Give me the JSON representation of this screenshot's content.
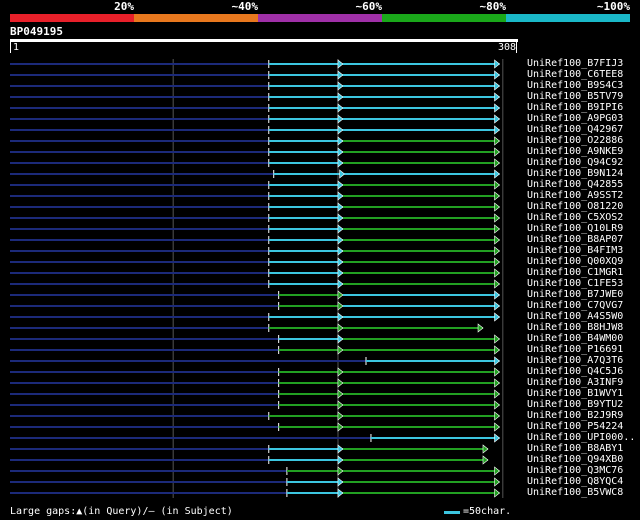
{
  "legend": {
    "labels": [
      "20%",
      "~40%",
      "~60%",
      "~80%",
      "~100%"
    ],
    "colors": [
      "#e8202a",
      "#e8781e",
      "#a030a8",
      "#1aa81a",
      "#1ab8c8"
    ]
  },
  "query": {
    "name": "BP049195",
    "start": "1",
    "end": "308"
  },
  "colors": {
    "cyan": "#3cc6e0",
    "green": "#22a022",
    "navy": "#1c2a7a",
    "grid": "#555555"
  },
  "hits": [
    {
      "label": "UniRef100_B7FIJ3",
      "segments": [
        {
          "start": 158,
          "end": 203,
          "color": "cyan"
        },
        {
          "start": 203,
          "end": 298,
          "color": "cyan"
        }
      ]
    },
    {
      "label": "UniRef100_C6TEE8",
      "segments": [
        {
          "start": 158,
          "end": 203,
          "color": "cyan"
        },
        {
          "start": 203,
          "end": 298,
          "color": "cyan"
        }
      ]
    },
    {
      "label": "UniRef100_B9S4C3",
      "segments": [
        {
          "start": 158,
          "end": 203,
          "color": "cyan"
        },
        {
          "start": 203,
          "end": 298,
          "color": "cyan"
        }
      ]
    },
    {
      "label": "UniRef100_B5TV79",
      "segments": [
        {
          "start": 158,
          "end": 203,
          "color": "cyan"
        },
        {
          "start": 203,
          "end": 298,
          "color": "cyan"
        }
      ]
    },
    {
      "label": "UniRef100_B9IPI6",
      "segments": [
        {
          "start": 158,
          "end": 203,
          "color": "cyan"
        },
        {
          "start": 203,
          "end": 298,
          "color": "cyan"
        }
      ]
    },
    {
      "label": "UniRef100_A9PG03",
      "segments": [
        {
          "start": 158,
          "end": 203,
          "color": "cyan"
        },
        {
          "start": 203,
          "end": 298,
          "color": "cyan"
        }
      ]
    },
    {
      "label": "UniRef100_Q42967",
      "segments": [
        {
          "start": 158,
          "end": 203,
          "color": "cyan"
        },
        {
          "start": 203,
          "end": 298,
          "color": "cyan"
        }
      ]
    },
    {
      "label": "UniRef100_O22886",
      "segments": [
        {
          "start": 158,
          "end": 203,
          "color": "cyan"
        },
        {
          "start": 203,
          "end": 298,
          "color": "green"
        }
      ]
    },
    {
      "label": "UniRef100_A9NKE9",
      "segments": [
        {
          "start": 158,
          "end": 203,
          "color": "cyan"
        },
        {
          "start": 203,
          "end": 298,
          "color": "green"
        }
      ]
    },
    {
      "label": "UniRef100_Q94C92",
      "segments": [
        {
          "start": 158,
          "end": 203,
          "color": "cyan"
        },
        {
          "start": 203,
          "end": 298,
          "color": "green"
        }
      ]
    },
    {
      "label": "UniRef100_B9N124",
      "segments": [
        {
          "start": 161,
          "end": 204,
          "color": "cyan"
        },
        {
          "start": 204,
          "end": 298,
          "color": "cyan"
        }
      ]
    },
    {
      "label": "UniRef100_Q42855",
      "segments": [
        {
          "start": 158,
          "end": 203,
          "color": "cyan"
        },
        {
          "start": 203,
          "end": 298,
          "color": "green"
        }
      ]
    },
    {
      "label": "UniRef100_A9SST2",
      "segments": [
        {
          "start": 158,
          "end": 203,
          "color": "cyan"
        },
        {
          "start": 203,
          "end": 298,
          "color": "green"
        }
      ]
    },
    {
      "label": "UniRef100_O81220",
      "segments": [
        {
          "start": 158,
          "end": 203,
          "color": "cyan"
        },
        {
          "start": 203,
          "end": 298,
          "color": "green"
        }
      ]
    },
    {
      "label": "UniRef100_C5XOS2",
      "segments": [
        {
          "start": 158,
          "end": 203,
          "color": "cyan"
        },
        {
          "start": 203,
          "end": 298,
          "color": "green"
        }
      ]
    },
    {
      "label": "UniRef100_Q10LR9",
      "segments": [
        {
          "start": 158,
          "end": 203,
          "color": "cyan"
        },
        {
          "start": 203,
          "end": 298,
          "color": "green"
        }
      ]
    },
    {
      "label": "UniRef100_B8AP07",
      "segments": [
        {
          "start": 158,
          "end": 203,
          "color": "cyan"
        },
        {
          "start": 203,
          "end": 298,
          "color": "green"
        }
      ]
    },
    {
      "label": "UniRef100_B4FIM3",
      "segments": [
        {
          "start": 158,
          "end": 203,
          "color": "cyan"
        },
        {
          "start": 203,
          "end": 298,
          "color": "green"
        }
      ]
    },
    {
      "label": "UniRef100_Q00XQ9",
      "segments": [
        {
          "start": 158,
          "end": 203,
          "color": "cyan"
        },
        {
          "start": 203,
          "end": 298,
          "color": "green"
        }
      ]
    },
    {
      "label": "UniRef100_C1MGR1",
      "segments": [
        {
          "start": 158,
          "end": 203,
          "color": "cyan"
        },
        {
          "start": 203,
          "end": 298,
          "color": "green"
        }
      ]
    },
    {
      "label": "UniRef100_C1FE53",
      "segments": [
        {
          "start": 158,
          "end": 203,
          "color": "cyan"
        },
        {
          "start": 203,
          "end": 298,
          "color": "green"
        }
      ]
    },
    {
      "label": "UniRef100_B7JWE0",
      "segments": [
        {
          "start": 164,
          "end": 203,
          "color": "green"
        },
        {
          "start": 203,
          "end": 298,
          "color": "cyan"
        }
      ]
    },
    {
      "label": "UniRef100_C7QVG7",
      "segments": [
        {
          "start": 164,
          "end": 203,
          "color": "green"
        },
        {
          "start": 203,
          "end": 298,
          "color": "cyan"
        }
      ]
    },
    {
      "label": "UniRef100_A4S5W0",
      "segments": [
        {
          "start": 158,
          "end": 203,
          "color": "cyan"
        },
        {
          "start": 203,
          "end": 298,
          "color": "cyan"
        }
      ]
    },
    {
      "label": "UniRef100_B8HJW8",
      "segments": [
        {
          "start": 158,
          "end": 203,
          "color": "green"
        },
        {
          "start": 203,
          "end": 288,
          "color": "green"
        }
      ]
    },
    {
      "label": "UniRef100_B4WM00",
      "segments": [
        {
          "start": 164,
          "end": 203,
          "color": "cyan"
        },
        {
          "start": 203,
          "end": 298,
          "color": "green"
        }
      ]
    },
    {
      "label": "UniRef100_P16691",
      "segments": [
        {
          "start": 164,
          "end": 203,
          "color": "green"
        },
        {
          "start": 203,
          "end": 298,
          "color": "green"
        }
      ]
    },
    {
      "label": "UniRef100_A7Q3T6",
      "segments": [
        {
          "start": 217,
          "end": 298,
          "color": "cyan"
        }
      ]
    },
    {
      "label": "UniRef100_Q4C5J6",
      "segments": [
        {
          "start": 164,
          "end": 203,
          "color": "green"
        },
        {
          "start": 203,
          "end": 298,
          "color": "green"
        }
      ]
    },
    {
      "label": "UniRef100_A3INF9",
      "segments": [
        {
          "start": 164,
          "end": 203,
          "color": "green"
        },
        {
          "start": 203,
          "end": 298,
          "color": "green"
        }
      ]
    },
    {
      "label": "UniRef100_B1WVY1",
      "segments": [
        {
          "start": 164,
          "end": 203,
          "color": "green"
        },
        {
          "start": 203,
          "end": 298,
          "color": "green"
        }
      ]
    },
    {
      "label": "UniRef100_B9YTU2",
      "segments": [
        {
          "start": 164,
          "end": 203,
          "color": "green"
        },
        {
          "start": 203,
          "end": 298,
          "color": "green"
        }
      ]
    },
    {
      "label": "UniRef100_B2J9R9",
      "segments": [
        {
          "start": 158,
          "end": 203,
          "color": "green"
        },
        {
          "start": 203,
          "end": 298,
          "color": "green"
        }
      ]
    },
    {
      "label": "UniRef100_P54224",
      "segments": [
        {
          "start": 164,
          "end": 203,
          "color": "green"
        },
        {
          "start": 203,
          "end": 298,
          "color": "green"
        }
      ]
    },
    {
      "label": "UniRef100_UPI000..",
      "segments": [
        {
          "start": 220,
          "end": 298,
          "color": "cyan"
        }
      ]
    },
    {
      "label": "UniRef100_B8ABY1",
      "segments": [
        {
          "start": 158,
          "end": 203,
          "color": "cyan"
        },
        {
          "start": 203,
          "end": 291,
          "color": "green"
        }
      ]
    },
    {
      "label": "UniRef100_Q94XB0",
      "segments": [
        {
          "start": 158,
          "end": 203,
          "color": "cyan"
        },
        {
          "start": 203,
          "end": 291,
          "color": "green"
        }
      ]
    },
    {
      "label": "UniRef100_Q3MC76",
      "segments": [
        {
          "start": 169,
          "end": 203,
          "color": "green"
        },
        {
          "start": 203,
          "end": 298,
          "color": "green"
        }
      ]
    },
    {
      "label": "UniRef100_Q8YQC4",
      "segments": [
        {
          "start": 169,
          "end": 203,
          "color": "cyan"
        },
        {
          "start": 203,
          "end": 298,
          "color": "green"
        }
      ]
    },
    {
      "label": "UniRef100_B5VWC8",
      "segments": [
        {
          "start": 169,
          "end": 203,
          "color": "cyan"
        },
        {
          "start": 203,
          "end": 298,
          "color": "green"
        }
      ]
    }
  ],
  "footer": {
    "gaps_text": "Large gaps:▲(in Query)/– (in Subject)",
    "scale_text": "=50char."
  }
}
